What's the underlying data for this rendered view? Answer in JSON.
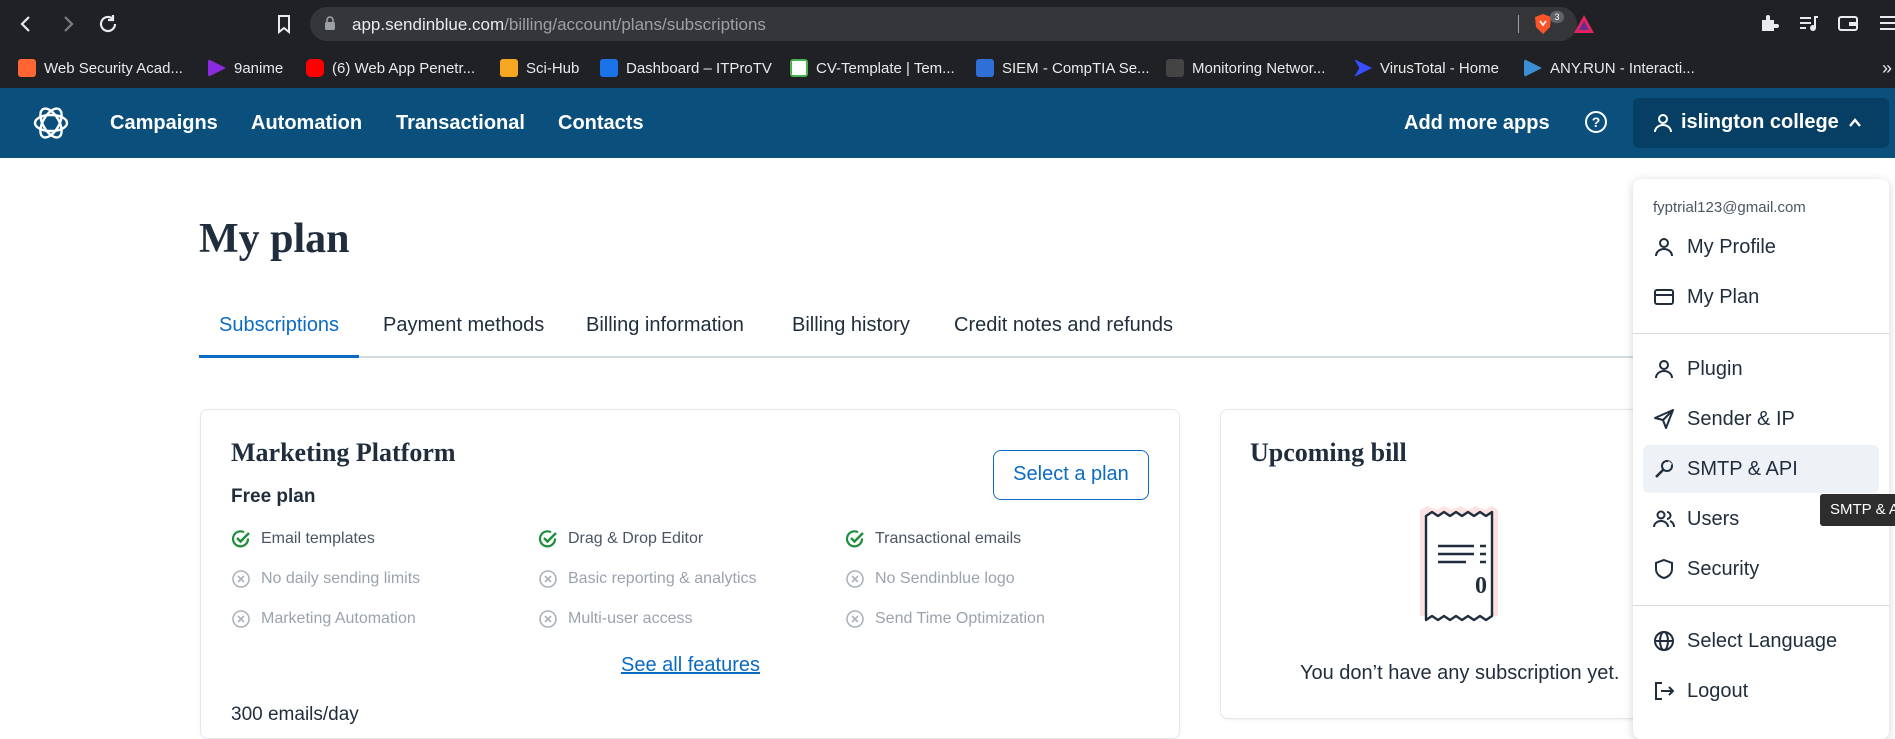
{
  "browser": {
    "url_host": "app.sendinblue.com",
    "url_path": "/billing/account/plans/subscriptions",
    "brave_badge": "3",
    "bookmarks": [
      {
        "label": "Web Security Acad...",
        "color": "#ff6633"
      },
      {
        "label": "9anime",
        "color": "#8a2be2"
      },
      {
        "label": "(6) Web App Penetr...",
        "color": "#ff0000"
      },
      {
        "label": "Sci-Hub",
        "color": "#f5a623"
      },
      {
        "label": "Dashboard – ITProTV",
        "color": "#1a73e8"
      },
      {
        "label": "CV-Template | Tem...",
        "color": "#ffffff"
      },
      {
        "label": "SIEM - CompTIA Se...",
        "color": "#2f6fd6"
      },
      {
        "label": "Monitoring Networ...",
        "color": "#444444"
      },
      {
        "label": "VirusTotal - Home",
        "color": "#394eff"
      },
      {
        "label": "ANY.RUN - Interacti...",
        "color": "#3b8fd6"
      }
    ],
    "bookmarks_overflow": "»"
  },
  "header": {
    "nav": [
      "Campaigns",
      "Automation",
      "Transactional",
      "Contacts"
    ],
    "add_apps": "Add more apps",
    "help": "?",
    "account": "islington college",
    "brand_color": "#0b4f7c"
  },
  "page": {
    "title": "My plan",
    "tabs": [
      "Subscriptions",
      "Payment methods",
      "Billing information",
      "Billing history",
      "Credit notes and refunds"
    ],
    "active_tab": "Subscriptions"
  },
  "marketing": {
    "title": "Marketing Platform",
    "plan": "Free plan",
    "select_button": "Select a plan",
    "features": [
      {
        "label": "Email templates",
        "included": true
      },
      {
        "label": "Drag & Drop Editor",
        "included": true
      },
      {
        "label": "Transactional emails",
        "included": true
      },
      {
        "label": "No daily sending limits",
        "included": false
      },
      {
        "label": "Basic reporting & analytics",
        "included": false
      },
      {
        "label": "No Sendinblue logo",
        "included": false
      },
      {
        "label": "Marketing Automation",
        "included": false
      },
      {
        "label": "Multi-user access",
        "included": false
      },
      {
        "label": "Send Time Optimization",
        "included": false
      }
    ],
    "see_all": "See all features",
    "emails_per_day": "300 emails/day"
  },
  "upcoming": {
    "title": "Upcoming bill",
    "receipt_value": "0",
    "empty_text": "You don’t have any subscription yet."
  },
  "dropdown": {
    "email": "fyptrial123@gmail.com",
    "items": [
      {
        "label": "My Profile",
        "icon": "user-icon"
      },
      {
        "label": "My Plan",
        "icon": "credit-card-icon"
      },
      {
        "label": "Plugin",
        "icon": "user-icon"
      },
      {
        "label": "Sender & IP",
        "icon": "paper-plane-icon"
      },
      {
        "label": "SMTP & API",
        "icon": "wrench-icon"
      },
      {
        "label": "Users",
        "icon": "users-icon"
      },
      {
        "label": "Security",
        "icon": "shield-icon"
      },
      {
        "label": "Select Language",
        "icon": "globe-icon"
      },
      {
        "label": "Logout",
        "icon": "logout-icon"
      }
    ],
    "hovered": "SMTP & API"
  },
  "tooltip": "SMTP & API"
}
